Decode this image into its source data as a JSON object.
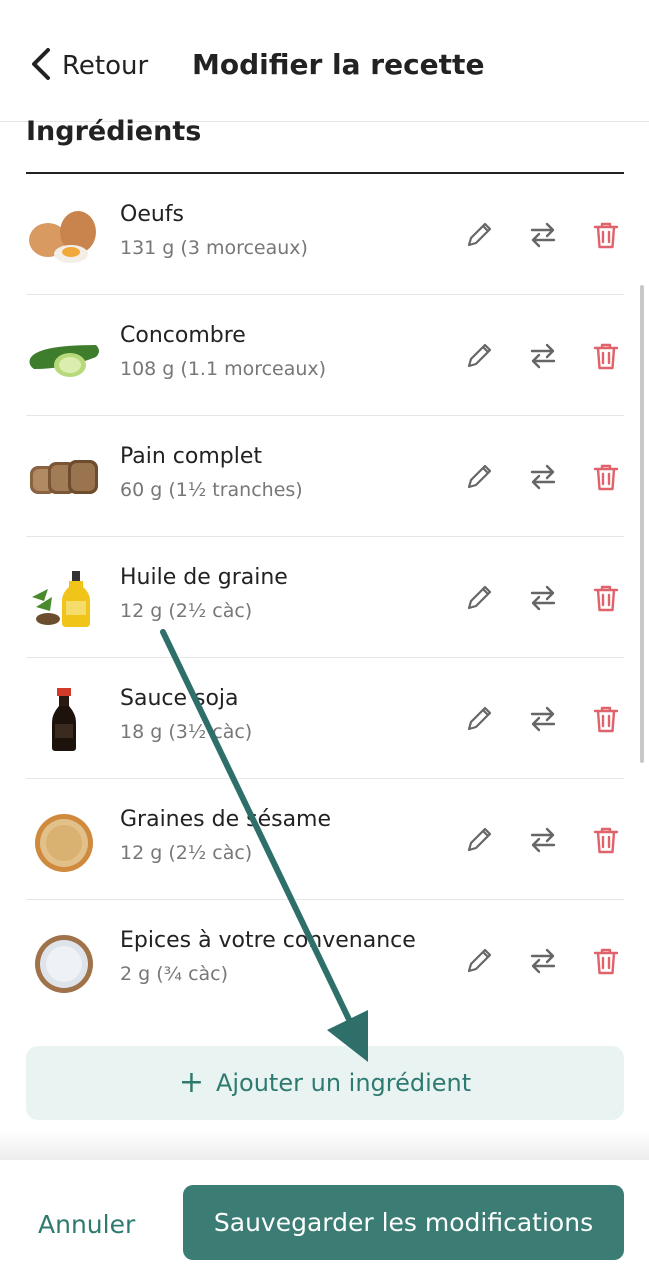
{
  "header": {
    "back_label": "Retour",
    "title": "Modifier la recette"
  },
  "section": {
    "title": "Ingrédients"
  },
  "ingredients": [
    {
      "name": "Oeufs",
      "qty": "131 g (3 morceaux)",
      "image": "eggs"
    },
    {
      "name": "Concombre",
      "qty": "108 g (1.1 morceaux)",
      "image": "cucumber"
    },
    {
      "name": "Pain complet",
      "qty": "60 g (1½ tranches)",
      "image": "bread"
    },
    {
      "name": "Huile de graine",
      "qty": "12 g (2½ càc)",
      "image": "oil"
    },
    {
      "name": "Sauce soja",
      "qty": "18 g (3½ càc)",
      "image": "soy-sauce"
    },
    {
      "name": "Graines de sésame",
      "qty": "12 g (2½ càc)",
      "image": "sesame"
    },
    {
      "name": "Epices à votre convenance",
      "qty": "2 g (¾ càc)",
      "image": "salt"
    }
  ],
  "actions": {
    "edit_icon": "pencil-icon",
    "swap_icon": "swap-arrows-icon",
    "delete_icon": "trash-icon"
  },
  "add": {
    "plus": "+",
    "label": "Ajouter un ingrédient"
  },
  "footer": {
    "cancel_label": "Annuler",
    "save_label": "Sauvegarder les modifications"
  },
  "colors": {
    "accent": "#3b7d74",
    "accent_text": "#2f7a70",
    "add_bg": "#e9f4f2",
    "delete": "#e0626a",
    "arrow": "#2f6f6a"
  }
}
